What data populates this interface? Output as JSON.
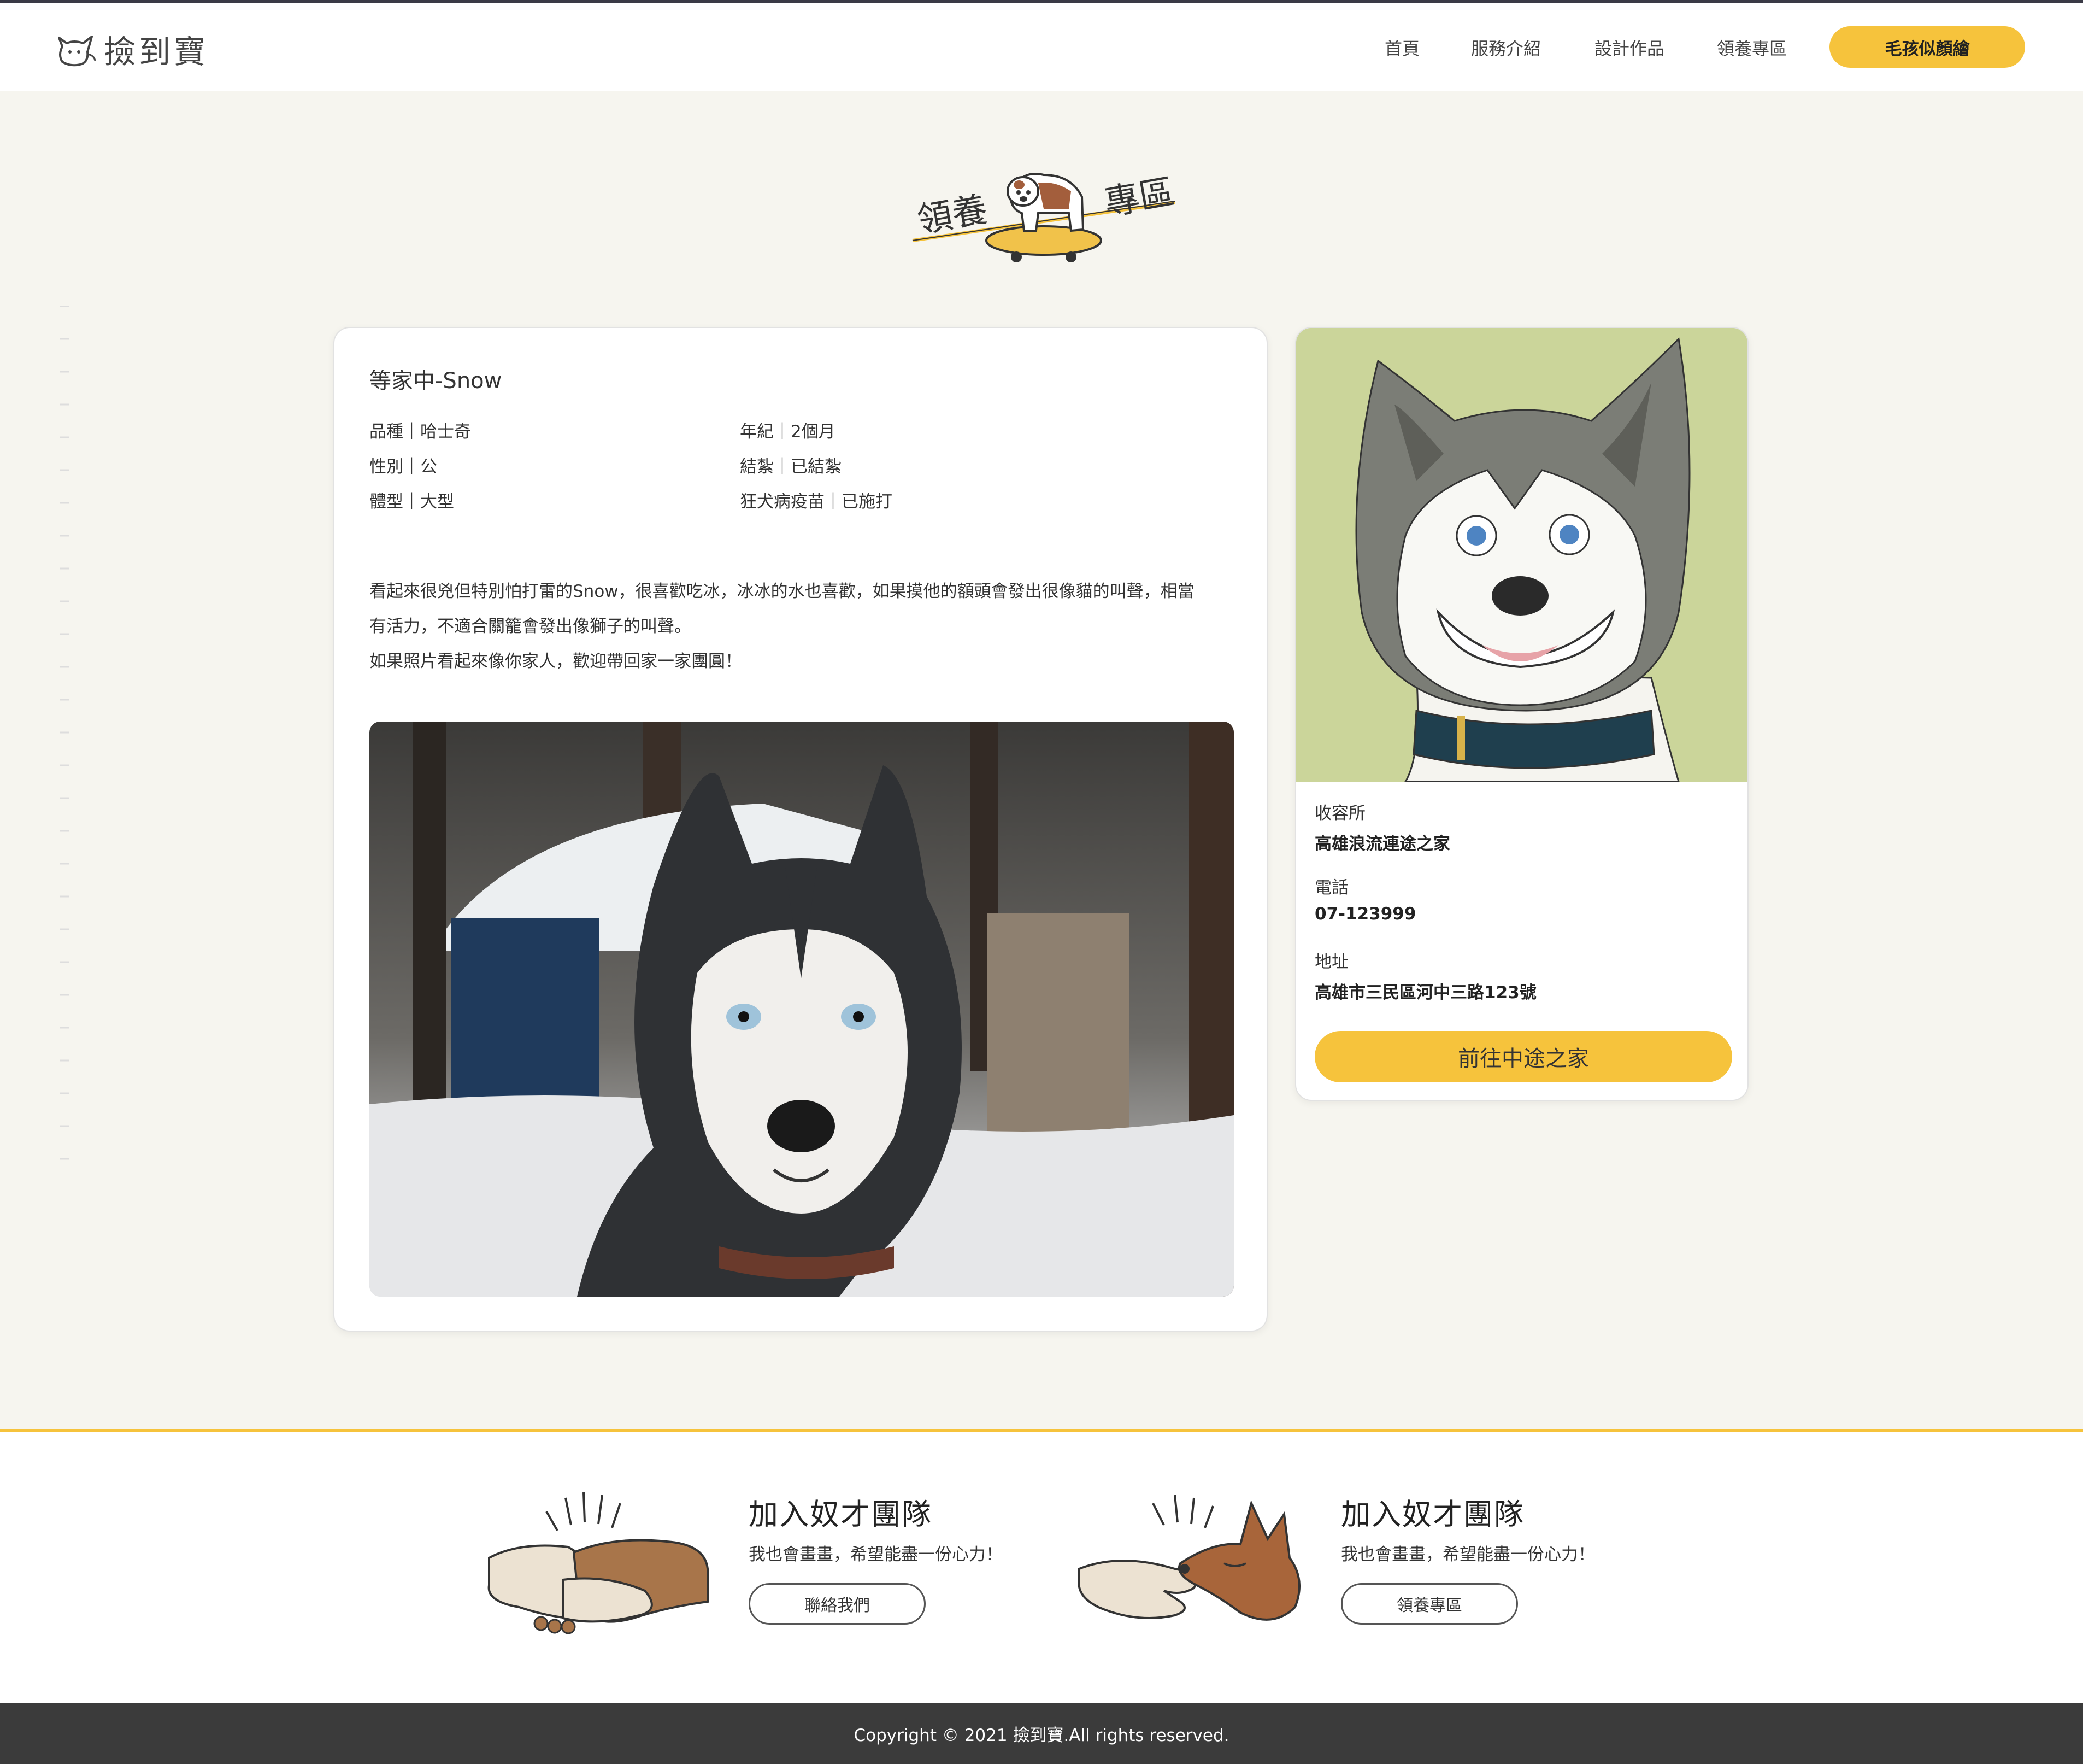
{
  "header": {
    "logo_text": "撿到寶",
    "nav": [
      "首頁",
      "服務介紹",
      "設計作品",
      "領養專區"
    ],
    "cta": "毛孩似顏繪"
  },
  "section_title": {
    "left": "領養",
    "right": "專區"
  },
  "pet": {
    "title": "等家中-Snow",
    "attrs": {
      "breed": "品種｜哈士奇",
      "age": "年紀｜2個月",
      "sex": "性別｜公",
      "neutered": "結紮｜已結紮",
      "size": "體型｜大型",
      "vaccine": "狂犬病疫苗｜已施打"
    },
    "desc_lines": [
      "看起來很兇但特別怕打雷的Snow，很喜歡吃冰，冰冰的水也喜歡，如果摸他的額頭會發出很像貓的叫聲，相當",
      "有活力，不適合關籠會發出像獅子的叫聲。",
      "如果照片看起來像你家人，歡迎帶回家一家團圓！"
    ]
  },
  "shelter": {
    "label_name": "收容所",
    "name": "高雄浪流連途之家",
    "label_phone": "電話",
    "phone": "07-123999",
    "label_address": "地址",
    "address": "高雄市三民區河中三路123號",
    "button": "前往中途之家"
  },
  "footer_ctas": [
    {
      "title": "加入奴才團隊",
      "sub": "我也會畫畫，希望能盡一份心力！",
      "button": "聯絡我們"
    },
    {
      "title": "加入奴才團隊",
      "sub": "我也會畫畫，希望能盡一份心力！",
      "button": "領養專區"
    }
  ],
  "copyright": "Copyright © 2021 撿到寶.All rights reserved.",
  "colors": {
    "accent": "#f6c33c",
    "dark": "#3b3b3b",
    "illus_bg": "#cbd59a"
  }
}
